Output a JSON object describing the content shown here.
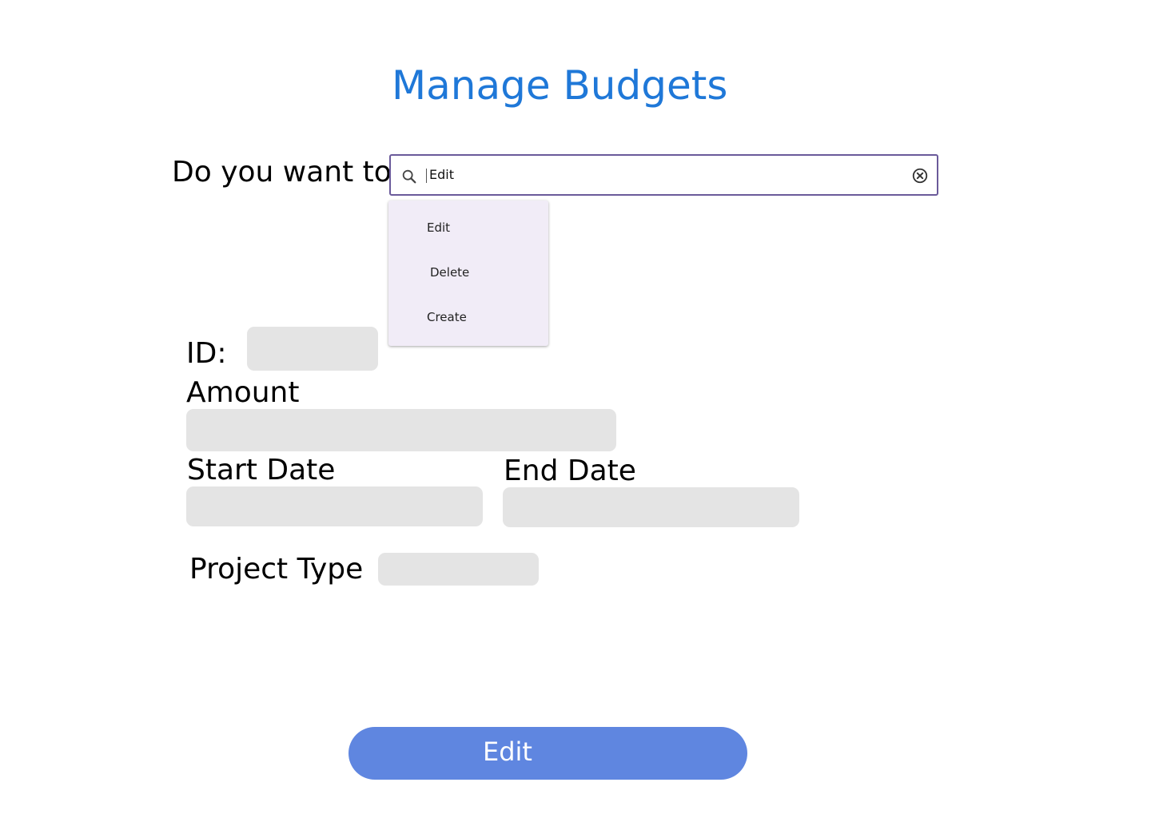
{
  "page": {
    "title": "Manage Budgets",
    "title_color": "#1f78d8"
  },
  "action_picker": {
    "label": "Do you want to",
    "search_value": "Edit",
    "search_icon": "search-icon",
    "clear_icon": "clear-circle-icon",
    "options": [
      "Edit",
      "Delete",
      "Create"
    ],
    "dropdown_background": "#f1ecf7",
    "border_color": "#6a5a9a"
  },
  "form": {
    "id_label": "ID:",
    "id_value": "",
    "amount_label": "Amount",
    "amount_value": "",
    "start_date_label": "Start Date",
    "start_date_value": "",
    "end_date_label": "End Date",
    "end_date_value": "",
    "project_type_label": "Project Type",
    "project_type_value": "",
    "field_background": "#e4e4e4"
  },
  "submit": {
    "label": "Edit",
    "background": "#5f86e0"
  }
}
